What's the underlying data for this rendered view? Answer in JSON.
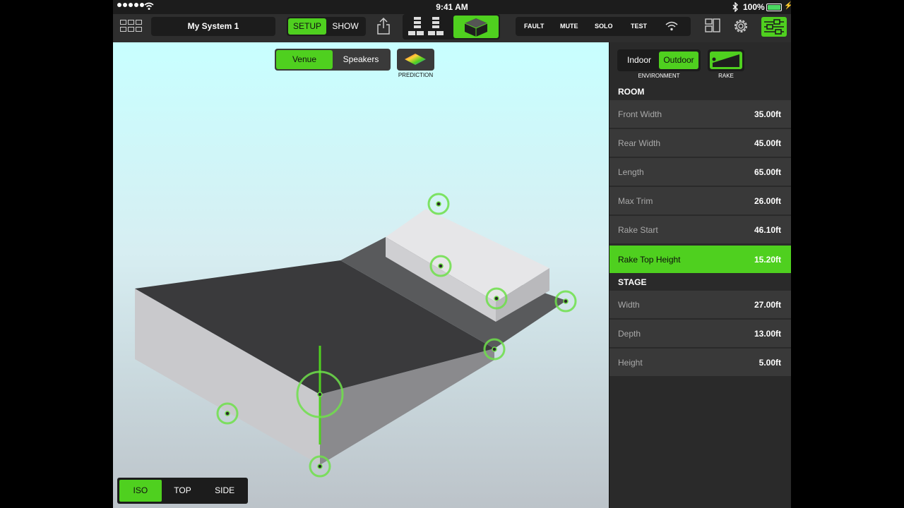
{
  "status_bar": {
    "time": "9:41 AM",
    "battery": "100%"
  },
  "toolbar": {
    "system_name": "My System 1",
    "setup_label": "SETUP",
    "show_label": "SHOW",
    "flags": [
      "FAULT",
      "MUTE",
      "SOLO",
      "TEST"
    ]
  },
  "viewport": {
    "venue_label": "Venue",
    "speakers_label": "Speakers",
    "prediction_label": "PREDICTION",
    "views": [
      "ISO",
      "TOP",
      "SIDE"
    ]
  },
  "panel": {
    "indoor_label": "Indoor",
    "outdoor_label": "Outdoor",
    "environment_label": "ENVIRONMENT",
    "rake_label": "RAKE",
    "room_title": "ROOM",
    "room": [
      {
        "label": "Front Width",
        "value": "35.00ft"
      },
      {
        "label": "Rear Width",
        "value": "45.00ft"
      },
      {
        "label": "Length",
        "value": "65.00ft"
      },
      {
        "label": "Max Trim",
        "value": "26.00ft"
      },
      {
        "label": "Rake Start",
        "value": "46.10ft"
      },
      {
        "label": "Rake Top Height",
        "value": "15.20ft"
      }
    ],
    "stage_title": "STAGE",
    "stage": [
      {
        "label": "Width",
        "value": "27.00ft"
      },
      {
        "label": "Depth",
        "value": "13.00ft"
      },
      {
        "label": "Height",
        "value": "5.00ft"
      }
    ]
  },
  "colors": {
    "accent": "#4fd01f",
    "panel_bg": "#2a2a2a",
    "row_bg": "#393939"
  }
}
